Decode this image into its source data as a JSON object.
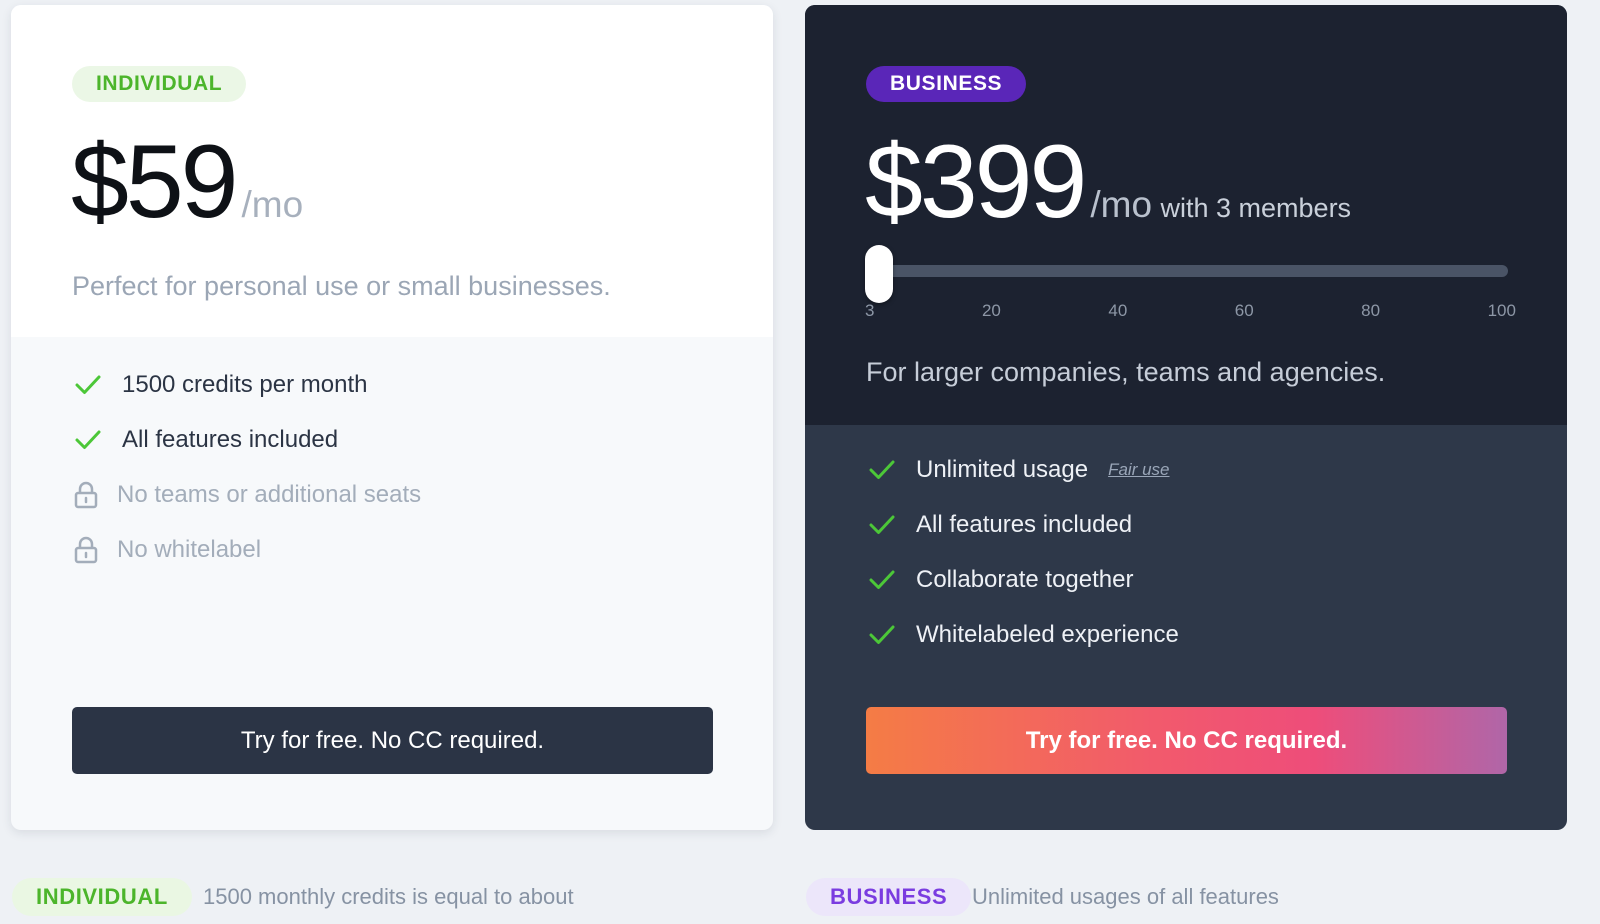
{
  "individual": {
    "badge": "INDIVIDUAL",
    "price": "$59",
    "per": "/mo",
    "tagline": "Perfect for personal use or small businesses.",
    "features": [
      {
        "label": "1500 credits per month",
        "icon": "check-icon",
        "enabled": true
      },
      {
        "label": "All features included",
        "icon": "check-icon",
        "enabled": true
      },
      {
        "label": "No teams or additional seats",
        "icon": "lock-icon",
        "enabled": false
      },
      {
        "label": "No whitelabel",
        "icon": "lock-icon",
        "enabled": false
      }
    ],
    "cta": "Try for free. No CC required."
  },
  "business": {
    "badge": "BUSINESS",
    "price": "$399",
    "per": "/mo",
    "members_text": "with 3 members",
    "slider": {
      "min": 3,
      "max": 100,
      "value": 3,
      "ticks": [
        "3",
        "20",
        "40",
        "60",
        "80",
        "100"
      ]
    },
    "tagline": "For larger companies, teams and agencies.",
    "features": [
      {
        "label": "Unlimited usage",
        "icon": "check-icon",
        "enabled": true,
        "link": "Fair use"
      },
      {
        "label": "All features included",
        "icon": "check-icon",
        "enabled": true
      },
      {
        "label": "Collaborate together",
        "icon": "check-icon",
        "enabled": true
      },
      {
        "label": "Whitelabeled experience",
        "icon": "check-icon",
        "enabled": true
      }
    ],
    "cta": "Try for free. No CC required."
  },
  "bottom": {
    "individual_badge": "INDIVIDUAL",
    "individual_text": "1500 monthly credits is equal to about",
    "business_badge": "BUSINESS",
    "business_text": "Unlimited usages of all features"
  },
  "colors": {
    "page_bg": "#eef1f5",
    "check_green": "#4cc738",
    "individual_badge_text": "#4cb52b",
    "business_badge_bg": "#5a26b8",
    "dark_card": "#1c2230",
    "dark_card_lower": "#2e3849"
  }
}
